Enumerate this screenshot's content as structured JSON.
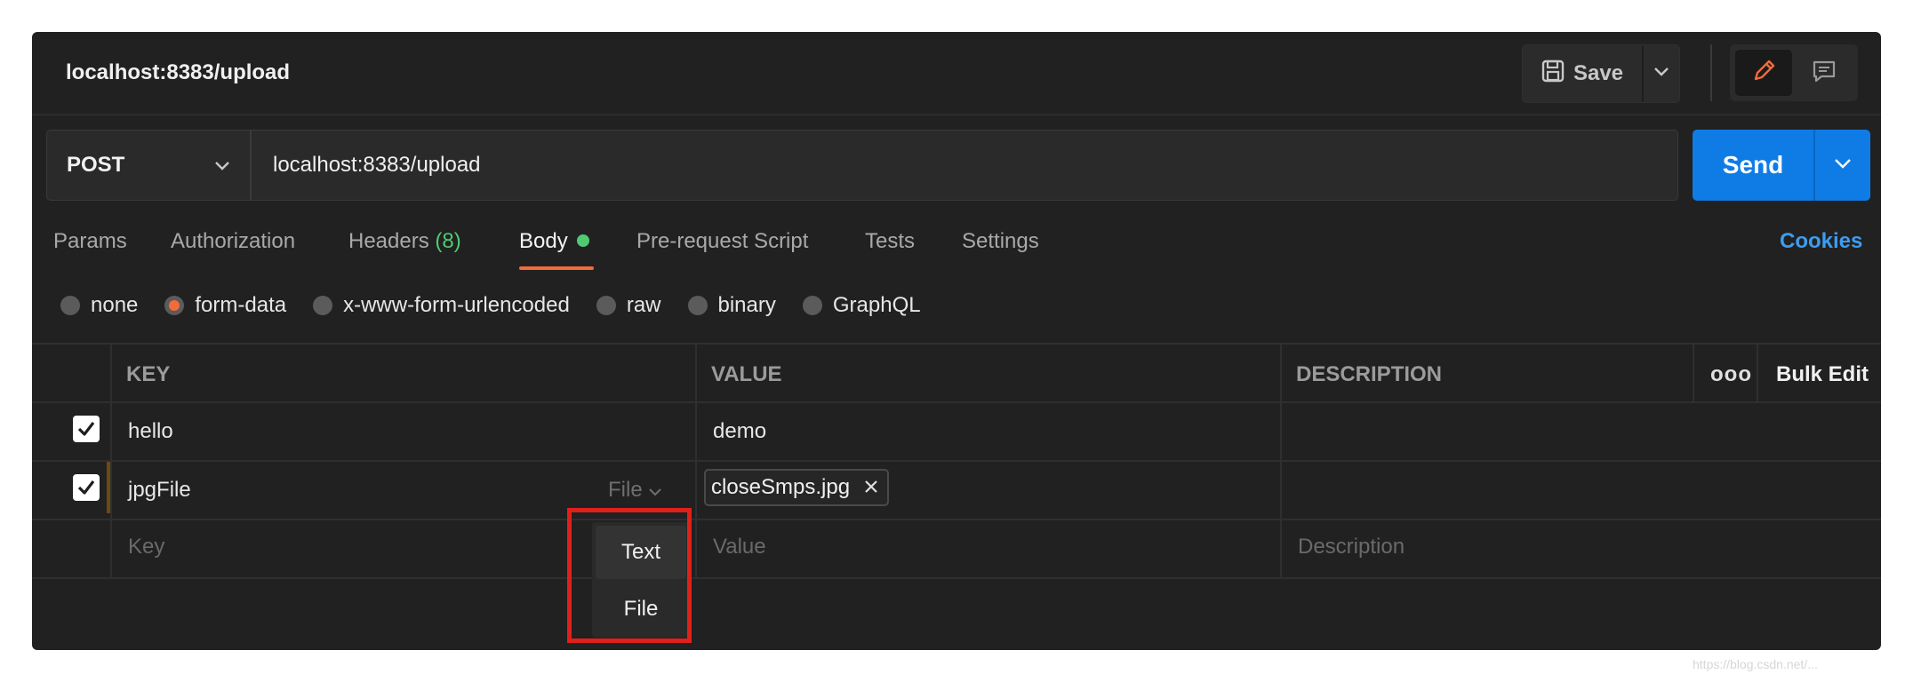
{
  "window": {
    "title": "localhost:8383/upload",
    "save_label": "Save"
  },
  "request": {
    "method": "POST",
    "url": "localhost:8383/upload",
    "send_label": "Send"
  },
  "tabs": [
    {
      "label": "Params"
    },
    {
      "label": "Authorization"
    },
    {
      "label": "Headers",
      "count": "(8)"
    },
    {
      "label": "Body",
      "active": true
    },
    {
      "label": "Pre-request Script"
    },
    {
      "label": "Tests"
    },
    {
      "label": "Settings"
    }
  ],
  "cookies_label": "Cookies",
  "body_modes": [
    {
      "label": "none",
      "selected": false
    },
    {
      "label": "form-data",
      "selected": true
    },
    {
      "label": "x-www-form-urlencoded",
      "selected": false
    },
    {
      "label": "raw",
      "selected": false
    },
    {
      "label": "binary",
      "selected": false
    },
    {
      "label": "GraphQL",
      "selected": false
    }
  ],
  "table": {
    "headers": {
      "key": "KEY",
      "value": "VALUE",
      "description": "DESCRIPTION",
      "more": "ooo",
      "bulk_edit": "Bulk Edit"
    },
    "rows": [
      {
        "checked": true,
        "key": "hello",
        "value": "demo"
      },
      {
        "checked": true,
        "key": "jpgFile",
        "type": "File",
        "file": "closeSmps.jpg"
      }
    ],
    "new_row": {
      "key_placeholder": "Key",
      "value_placeholder": "Value",
      "description_placeholder": "Description"
    }
  },
  "type_menu": {
    "items": [
      "Text",
      "File"
    ],
    "highlighted": "Text"
  },
  "colors": {
    "accent": "#f26b3a",
    "send": "#0f7ce6",
    "cookies": "#3d9cf0",
    "status_green": "#4ecb71",
    "annotation_red": "#e0201a"
  },
  "watermark": "https://blog.csdn.net/..."
}
